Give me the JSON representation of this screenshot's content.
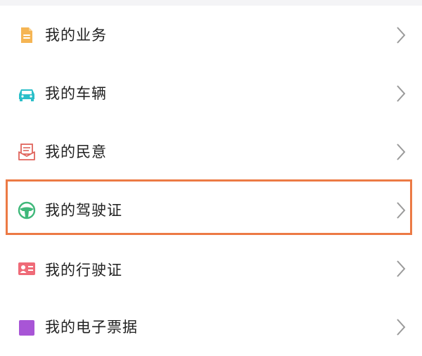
{
  "menu": {
    "items": [
      {
        "label": "我的业务",
        "icon": "document-icon",
        "color": "#f5b553"
      },
      {
        "label": "我的车辆",
        "icon": "car-icon",
        "color": "#2bbfc9"
      },
      {
        "label": "我的民意",
        "icon": "mailbox-icon",
        "color": "#e0645c"
      },
      {
        "label": "我的驾驶证",
        "icon": "steering-wheel-icon",
        "color": "#3fb87a"
      },
      {
        "label": "我的行驶证",
        "icon": "id-card-icon",
        "color": "#ef6b78"
      },
      {
        "label": "我的电子票据",
        "icon": "ticket-icon",
        "color": "#a855d6"
      }
    ]
  },
  "highlight_color": "#ec7a45"
}
